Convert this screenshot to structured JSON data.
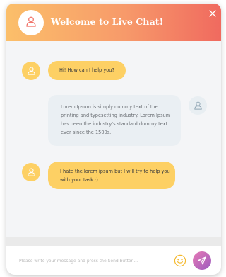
{
  "header": {
    "title": "Welcome to Live Chat!",
    "avatar_icon": "user-icon",
    "close_icon": "close-icon",
    "gradient": [
      "#fbbf6a",
      "#f06a5f"
    ]
  },
  "messages": [
    {
      "sender": "bot",
      "text": "Hi! How can I help you?",
      "avatar_icon": "user-icon"
    },
    {
      "sender": "user",
      "lines": [
        "Lorem Ipsum is simply dummy text of the",
        "printing and typesetting industry. Lorem Ipsum",
        "has been the industry's standard dummy text",
        "ever since the 1500s."
      ],
      "avatar_icon": "user-icon"
    },
    {
      "sender": "bot",
      "lines": [
        "I hate the lorem ipsum but I will try to help you",
        "with your task :)"
      ],
      "avatar_icon": "user-icon"
    }
  ],
  "composer": {
    "placeholder": "Please write your message and press the Send button...",
    "emoji_icon": "smiley-icon",
    "send_icon": "send-icon"
  },
  "colors": {
    "bot_bubble": "#fdd064",
    "user_bubble": "#eaeff3",
    "send_button": "#c36ab9"
  }
}
